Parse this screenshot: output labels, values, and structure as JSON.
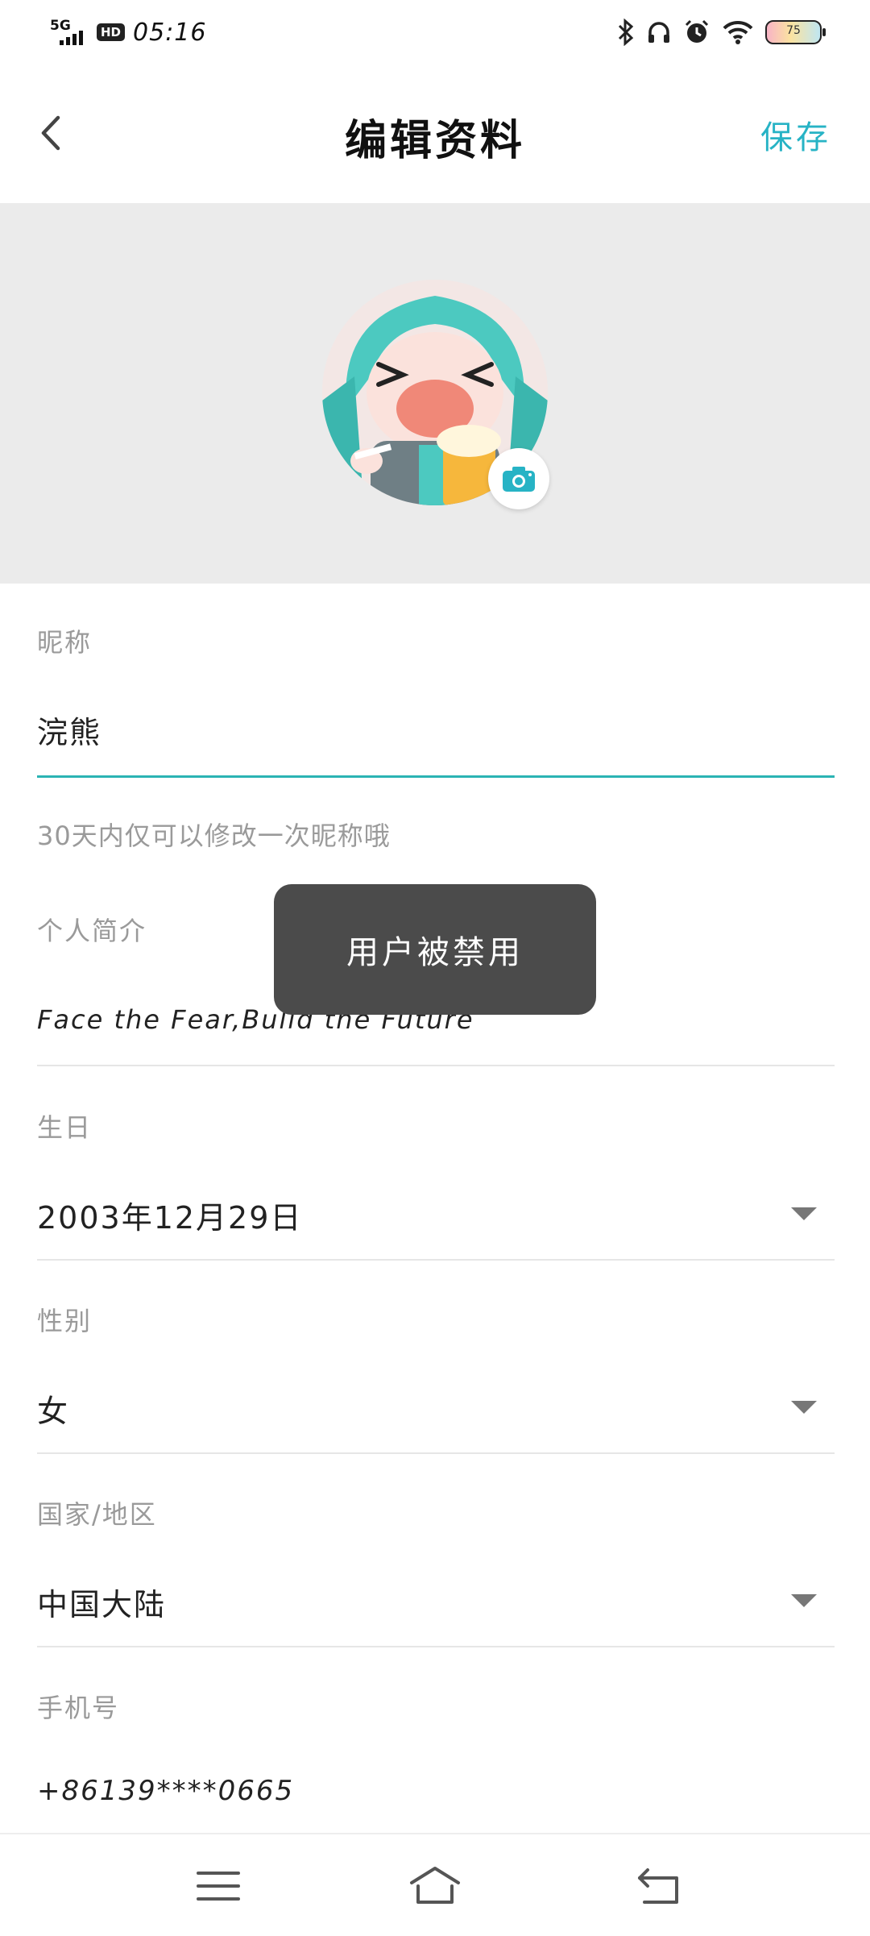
{
  "status_bar": {
    "network": "5G",
    "hd": "HD",
    "time": "05:16",
    "battery": "75"
  },
  "header": {
    "title": "编辑资料",
    "save_label": "保存"
  },
  "toast": "用户被禁用",
  "form": {
    "nickname": {
      "label": "昵称",
      "value": "浣熊",
      "hint": "30天内仅可以修改一次昵称哦"
    },
    "bio": {
      "label": "个人简介",
      "value": "Face the Fear,Bulid the Future"
    },
    "birthday": {
      "label": "生日",
      "value": "2003年12月29日"
    },
    "gender": {
      "label": "性别",
      "value": "女"
    },
    "region": {
      "label": "国家/地区",
      "value": "中国大陆"
    },
    "phone": {
      "label": "手机号",
      "value": "+86139****0665"
    }
  },
  "colors": {
    "accent": "#27b3c5",
    "toast_bg": "#4b4b4b",
    "avatar_bg": "#ebebeb"
  }
}
